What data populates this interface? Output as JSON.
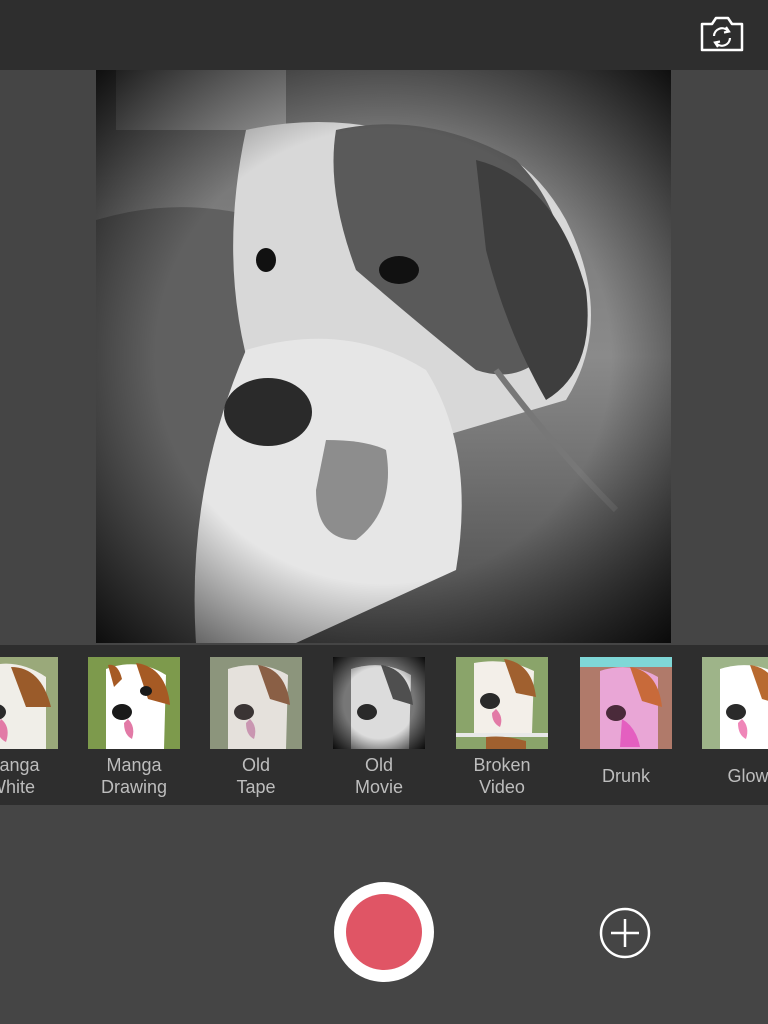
{
  "top_bar": {
    "switch_camera_icon": "camera-switch-icon"
  },
  "preview": {
    "filter_applied": "Old Movie",
    "subject": "dog-photo"
  },
  "filters": [
    {
      "label": "Manga\nWhite",
      "style": "color"
    },
    {
      "label": "Manga\nDrawing",
      "style": "color"
    },
    {
      "label": "Old\nTape",
      "style": "muted"
    },
    {
      "label": "Old\nMovie",
      "style": "bw",
      "selected": true
    },
    {
      "label": "Broken\nVideo",
      "style": "color"
    },
    {
      "label": "Drunk",
      "style": "pink"
    },
    {
      "label": "Glow",
      "style": "color"
    }
  ],
  "controls": {
    "record_icon": "record-icon",
    "add_icon": "plus-circle-icon",
    "record_color": "#e05565"
  }
}
